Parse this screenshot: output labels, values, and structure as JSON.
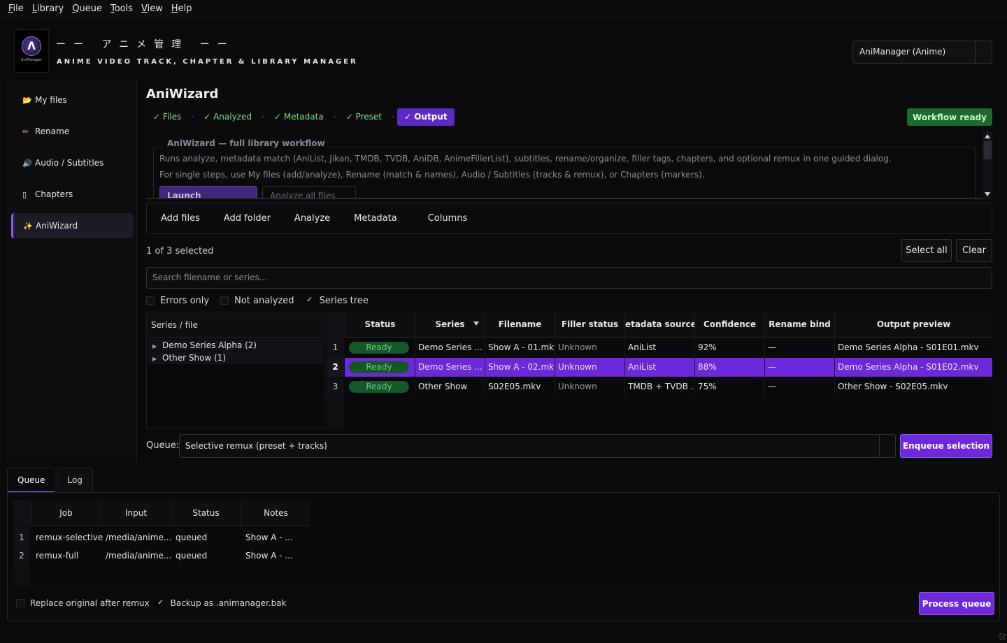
{
  "menubar": {
    "items": [
      "File",
      "Library",
      "Queue",
      "Tools",
      "View",
      "Help"
    ]
  },
  "header": {
    "logo_text": "AniManager",
    "logo_subtext": "—— ——",
    "title_jp": "ーー アニメ管理 ーー",
    "subtitle": "ANIME VIDEO TRACK, CHAPTER & LIBRARY MANAGER",
    "profile": "AniManager (Anime)"
  },
  "sidebar": {
    "items": [
      {
        "label": "My files",
        "icon": "folder-icon"
      },
      {
        "label": "Rename",
        "icon": "pencil-icon"
      },
      {
        "label": "Audio / Subtitles",
        "icon": "speaker-icon"
      },
      {
        "label": "Chapters",
        "icon": "page-icon"
      },
      {
        "label": "AniWizard",
        "icon": "sparkles-icon",
        "active": true
      }
    ]
  },
  "wizard": {
    "title": "AniWizard",
    "steps": [
      "✓ Files",
      "✓ Analyzed",
      "✓ Metadata",
      "✓ Preset",
      "✓ Output"
    ],
    "status": "Workflow ready",
    "box_title": "AniWizard — full library workflow",
    "line1": "Runs analyze, metadata match (AniList, Jikan, TMDB, TVDB, AniDB, AnimeFillerList), subtitles, rename/organize, filler tags, chapters, and optional remux in one guided dialog.",
    "line2": "For single steps, use My files (add/analyze), Rename (match & names), Audio / Subtitles (tracks & remux), or Chapters (markers).",
    "launch_button": "Launch AniWizard",
    "analyze_button": "Analyze all files first"
  },
  "toolbar": {
    "add_files": "Add files",
    "add_folder": "Add folder",
    "analyze": "Analyze",
    "metadata": "Metadata",
    "columns": "Columns"
  },
  "selection": {
    "count": "1 of 3 selected",
    "select_all": "Select all",
    "clear": "Clear"
  },
  "search": {
    "placeholder": "Search filename or series..."
  },
  "filters": {
    "errors_only": "Errors only",
    "not_analyzed": "Not analyzed",
    "series_tree": "Series tree",
    "series_tree_checked": true
  },
  "tree": {
    "header": "Series / file",
    "items": [
      "Demo Series Alpha (2)",
      "Other Show (1)"
    ]
  },
  "files_table": {
    "headers": [
      "Status",
      "Series",
      "Filename",
      "Filler status",
      "Metadata source",
      "Confidence",
      "Rename bind",
      "Output preview"
    ],
    "rows": [
      {
        "num": "1",
        "status": "Ready",
        "series": "Demo Series ...",
        "filename": "Show A - 01.mkv",
        "filler": "Unknown",
        "source": "AniList",
        "confidence": "92%",
        "bind": "—",
        "output": "Demo Series Alpha - S01E01.mkv",
        "selected": false
      },
      {
        "num": "2",
        "status": "Ready",
        "series": "Demo Series ...",
        "filename": "Show A - 02.mkv",
        "filler": "Unknown",
        "source": "AniList",
        "confidence": "88%",
        "bind": "—",
        "output": "Demo Series Alpha - S01E02.mkv",
        "selected": true
      },
      {
        "num": "3",
        "status": "Ready",
        "series": "Other Show",
        "filename": "S02E05.mkv",
        "filler": "Unknown",
        "source": "TMDB + TVDB ...",
        "confidence": "75%",
        "bind": "—",
        "output": "Other Show - S02E05.mkv",
        "selected": false
      }
    ]
  },
  "queue_select": {
    "label": "Queue:",
    "value": "Selective remux (preset + tracks)",
    "enqueue": "Enqueue selection"
  },
  "bottom_tabs": [
    "Queue",
    "Log"
  ],
  "queue_table": {
    "headers": [
      "Job",
      "Input",
      "Status",
      "Notes"
    ],
    "rows": [
      {
        "num": "1",
        "job": "remux-selective",
        "input": "/media/anime...",
        "status": "queued",
        "notes": "Show A - ..."
      },
      {
        "num": "2",
        "job": "remux-full",
        "input": "/media/anime...",
        "status": "queued",
        "notes": "Show A - ..."
      }
    ]
  },
  "queue_options": {
    "replace_original": "Replace original after remux",
    "backup": "Backup as .animanager.bak",
    "backup_checked": true
  },
  "process_button": "Process queue",
  "colors": {
    "accent": "#6d28d9",
    "ready_green": "#1c6a2c",
    "background": "#0b0b0d"
  }
}
